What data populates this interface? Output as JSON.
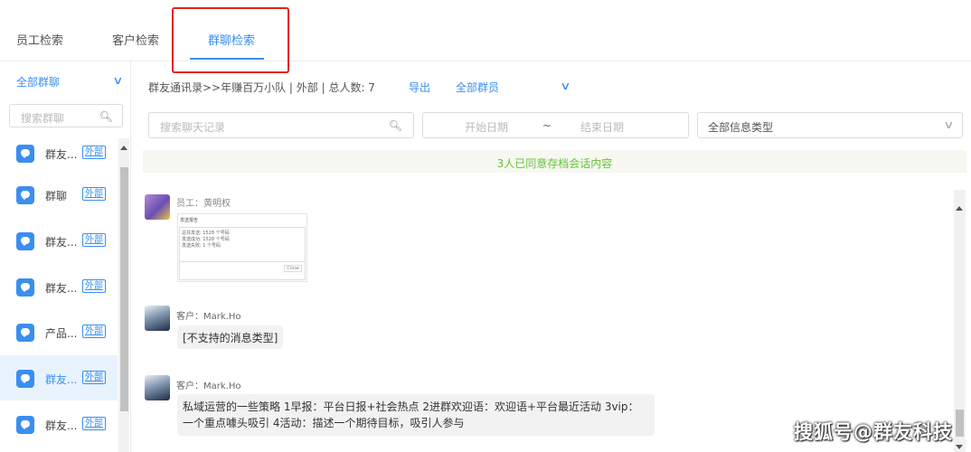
{
  "tabs": [
    {
      "label": "员工检索"
    },
    {
      "label": "客户检索"
    },
    {
      "label": "群聊检索",
      "active": true
    }
  ],
  "sidebar": {
    "filter": "全部群聊",
    "search_placeholder": "搜索群聊",
    "items": [
      {
        "name": "群友...",
        "tag": "外部"
      },
      {
        "name": "群聊",
        "tag": "外部"
      },
      {
        "name": "群友...",
        "tag": "外部"
      },
      {
        "name": "群友...",
        "tag": "外部"
      },
      {
        "name": "产品...",
        "tag": "外部"
      },
      {
        "name": "群友...",
        "tag": "外部",
        "active": true
      },
      {
        "name": "群友...",
        "tag": "外部"
      }
    ]
  },
  "main": {
    "breadcrumb": "群友通讯录>>年赚百万小队 | 外部 | 总人数: 7",
    "export": "导出",
    "members": "全部群员",
    "chat_search_placeholder": "搜索聊天记录",
    "date_start": "开始日期",
    "date_sep": "~",
    "date_end": "结束日期",
    "message_type": "全部信息类型",
    "consent": "3人已同意存档会话内容"
  },
  "messages": [
    {
      "sender": "员工：黄明权",
      "image": {
        "title": "发送报告",
        "lines": [
          "总共发送: 1528 个号码",
          "发送成功: 1528 个号码",
          "发送失败: 1 个号码"
        ],
        "button": "Close"
      }
    },
    {
      "sender": "客户：Mark.Ho",
      "text": "[不支持的消息类型]"
    },
    {
      "sender": "客户：Mark.Ho",
      "text_line1": "私域运营的一些策略 1早报：平台日报+社会热点 2进群欢迎语：欢迎语+平台最近活动 3vip：",
      "text_line2": "一个重点噱头吸引 4活动：描述一个期待目标，吸引人参与"
    }
  ],
  "watermark": "搜狐号@群友科技",
  "colors": {
    "accent": "#3a8ef0",
    "consent": "#67c23a",
    "highlight": "#e02020"
  }
}
